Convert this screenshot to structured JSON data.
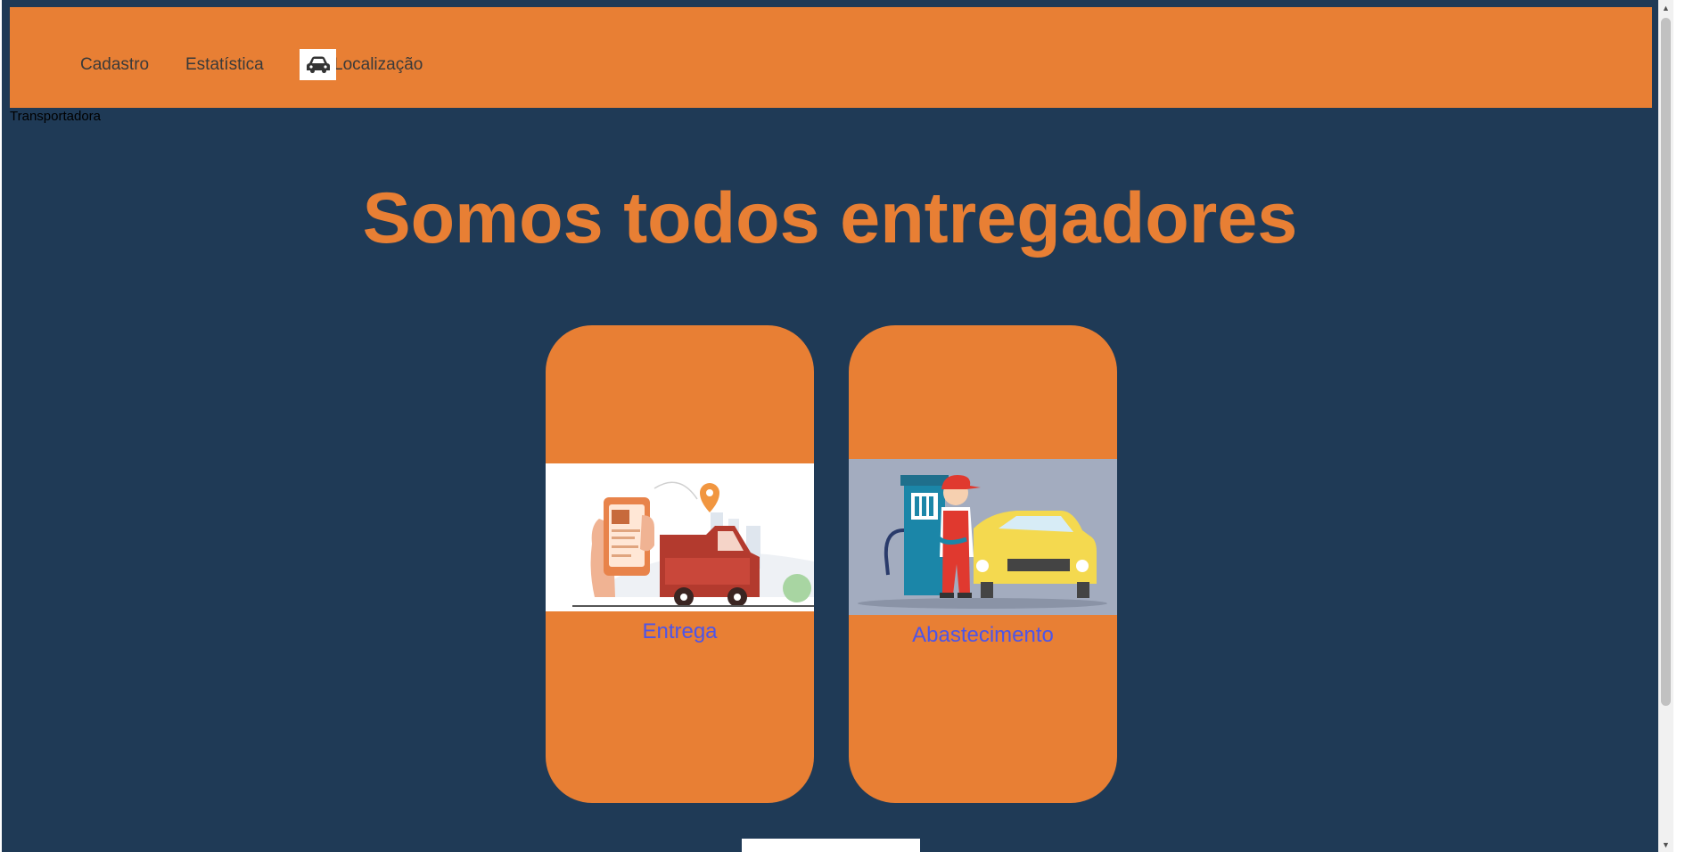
{
  "nav": {
    "items": [
      {
        "label": "Cadastro"
      },
      {
        "label": "Estatística"
      },
      {
        "label": "Localização"
      }
    ],
    "logo_icon": "car-icon"
  },
  "brand": "Transportadora",
  "headline": "Somos todos entregadores",
  "cards": [
    {
      "label": "Entrega",
      "image": "delivery-truck-illustration"
    },
    {
      "label": "Abastecimento",
      "image": "fuel-station-attendant-illustration"
    }
  ],
  "colors": {
    "background": "#1f3a56",
    "accent": "#e87f34",
    "link": "#4d55e8"
  }
}
